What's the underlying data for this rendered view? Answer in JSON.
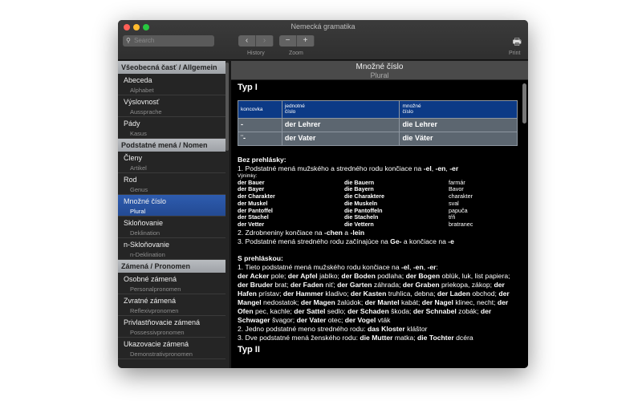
{
  "window": {
    "title": "Nemecká gramatika"
  },
  "toolbar": {
    "search_placeholder": "Search",
    "back": "‹",
    "forward": "›",
    "zoom_out": "−",
    "zoom_in": "+",
    "history_label": "History",
    "zoom_label": "Zoom",
    "print_label": "Print"
  },
  "colors": {
    "accent": "#2e5cb0",
    "table_header": "#0c3a86",
    "table_row": "#5c6670"
  },
  "sidebar": [
    {
      "type": "header",
      "label": "Všeobecná časť / Allgemein"
    },
    {
      "type": "item",
      "label": "Abeceda",
      "sub": "Alphabet"
    },
    {
      "type": "item",
      "label": "Výslovnosť",
      "sub": "Aussprache"
    },
    {
      "type": "item",
      "label": "Pády",
      "sub": "Kasus"
    },
    {
      "type": "header",
      "label": "Podstatné mená / Nomen"
    },
    {
      "type": "item",
      "label": "Členy",
      "sub": "Artikel"
    },
    {
      "type": "item",
      "label": "Rod",
      "sub": "Genus"
    },
    {
      "type": "item",
      "label": "Množné číslo",
      "sub": "Plural",
      "selected": true
    },
    {
      "type": "item",
      "label": "Skloňovanie",
      "sub": "Deklination"
    },
    {
      "type": "item",
      "label": "n-Skloňovanie",
      "sub": "n-Deklination"
    },
    {
      "type": "header",
      "label": "Zámená / Pronomen"
    },
    {
      "type": "item",
      "label": "Osobné zámená",
      "sub": "Personalpronomen"
    },
    {
      "type": "item",
      "label": "Zvratné zámená",
      "sub": "Reflexivpronomen"
    },
    {
      "type": "item",
      "label": "Privlastňovacie zámená",
      "sub": "Possessivpronomen"
    },
    {
      "type": "item",
      "label": "Ukazovacie zámená",
      "sub": "Demonstrativpronomen"
    }
  ],
  "content": {
    "title": "Množné číslo",
    "subtitle": "Plural",
    "section1": "Typ I",
    "table": {
      "headers": [
        "koncovka",
        "jednotné\nčíslo",
        "množné\nčíslo"
      ],
      "rows": [
        [
          "-",
          "der Lehrer",
          "die Lehrer"
        ],
        [
          "¨-",
          "der Vater",
          "die Väter"
        ]
      ]
    },
    "bez_heading": "Bez prehlásky:",
    "bez_1": [
      [
        "1. Podstatné mená mužského a stredného rodu končiace na ",
        0
      ],
      [
        "-el",
        1
      ],
      [
        ", ",
        0
      ],
      [
        "-en",
        1
      ],
      [
        ", ",
        0
      ],
      [
        "-er",
        1
      ]
    ],
    "exceptions_label": "Výnimky:",
    "exceptions": [
      [
        "der Bauer",
        "die Bauern",
        "farmár"
      ],
      [
        "der Bayer",
        "die Bayern",
        "Bavor"
      ],
      [
        "der Charakter",
        "die Charaktere",
        "charakter"
      ],
      [
        "der Muskel",
        "die Muskeln",
        "sval"
      ],
      [
        "der Pantoffel",
        "die Pantoffeln",
        "papuča"
      ],
      [
        "der Stachel",
        "die Stacheln",
        "tŕň"
      ],
      [
        "der Vetter",
        "die Vettern",
        "bratranec"
      ]
    ],
    "bez_2": [
      [
        "2. Zdrobneniny končiace na ",
        0
      ],
      [
        "-chen",
        1
      ],
      [
        " a ",
        0
      ],
      [
        "-lein",
        1
      ]
    ],
    "bez_3": [
      [
        "3. Podstatné mená stredného rodu začínajúce na ",
        0
      ],
      [
        "Ge-",
        1
      ],
      [
        " a končiace na ",
        0
      ],
      [
        "-e",
        1
      ]
    ],
    "s_heading": "S prehláskou:",
    "s_1": [
      [
        "1. Tieto podstatné mená mužského rodu končiace na ",
        0
      ],
      [
        "-el",
        1
      ],
      [
        ", ",
        0
      ],
      [
        "-en",
        1
      ],
      [
        ", ",
        0
      ],
      [
        "-er",
        1
      ],
      [
        ":",
        0
      ]
    ],
    "s_1_words": [
      [
        "der Acker",
        1
      ],
      [
        " pole; ",
        0
      ],
      [
        "der Apfel",
        1
      ],
      [
        " jablko; ",
        0
      ],
      [
        "der Boden",
        1
      ],
      [
        " podlaha; ",
        0
      ],
      [
        "der Bogen",
        1
      ],
      [
        " oblúk, luk, list papiera; ",
        0
      ],
      [
        "der Bruder",
        1
      ],
      [
        " brat; ",
        0
      ],
      [
        "der Faden",
        1
      ],
      [
        " niť; ",
        0
      ],
      [
        "der Garten",
        1
      ],
      [
        " záhrada; ",
        0
      ],
      [
        "der Graben",
        1
      ],
      [
        " priekopa, zákop; ",
        0
      ],
      [
        "der Hafen",
        1
      ],
      [
        " prístav; ",
        0
      ],
      [
        "der Hammer",
        1
      ],
      [
        " kladivo; ",
        0
      ],
      [
        "der Kasten",
        1
      ],
      [
        " truhlica, debna; ",
        0
      ],
      [
        "der Laden",
        1
      ],
      [
        " obchod; ",
        0
      ],
      [
        "der Mangel",
        1
      ],
      [
        " nedostatok; ",
        0
      ],
      [
        "der Magen",
        1
      ],
      [
        " žalúdok; ",
        0
      ],
      [
        "der Mantel",
        1
      ],
      [
        " kabát; ",
        0
      ],
      [
        "der Nagel",
        1
      ],
      [
        " klinec, necht; ",
        0
      ],
      [
        "der Ofen",
        1
      ],
      [
        " pec, kachle; ",
        0
      ],
      [
        "der Sattel",
        1
      ],
      [
        " sedlo; ",
        0
      ],
      [
        "der Schaden",
        1
      ],
      [
        " škoda; ",
        0
      ],
      [
        "der Schnabel",
        1
      ],
      [
        " zobák; ",
        0
      ],
      [
        "der Schwager",
        1
      ],
      [
        " švagor; ",
        0
      ],
      [
        "der Vater",
        1
      ],
      [
        " otec; ",
        0
      ],
      [
        "der Vogel",
        1
      ],
      [
        " vták",
        0
      ]
    ],
    "s_2": [
      [
        "2. Jedno podstatné meno stredného rodu: ",
        0
      ],
      [
        "das Kloster",
        1
      ],
      [
        " kláštor",
        0
      ]
    ],
    "s_3": [
      [
        "3. Dve podstatné mená ženského rodu: ",
        0
      ],
      [
        "die Mutter",
        1
      ],
      [
        " matka; ",
        0
      ],
      [
        "die Tochter",
        1
      ],
      [
        " dcéra",
        0
      ]
    ],
    "section2": "Typ II"
  }
}
